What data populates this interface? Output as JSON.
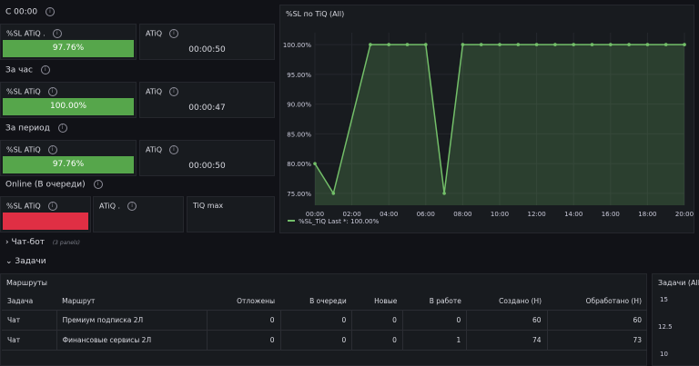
{
  "rows": [
    {
      "label": "С 00:00",
      "sl_title": "%SL ATiQ .",
      "sl_value": "97.76%",
      "atiq_title": "ATiQ",
      "atiq_value": "00:00:50"
    },
    {
      "label": "За час",
      "sl_title": "%SL ATiQ",
      "sl_value": "100.00%",
      "atiq_title": "ATiQ",
      "atiq_value": "00:00:47"
    },
    {
      "label": "За период",
      "sl_title": "%SL ATiQ",
      "sl_value": "97.76%",
      "atiq_title": "ATiQ",
      "atiq_value": "00:00:50"
    }
  ],
  "online": {
    "label": "Online (В очереди)",
    "sl_title": "%SL ATiQ",
    "atiq_title": "ATiQ .",
    "tiqmax_title": "TiQ max"
  },
  "info_glyph": "i",
  "chatbot": {
    "label": "Чат-бот",
    "panels": "(3 panels)"
  },
  "tasks": {
    "label": "Задачи"
  },
  "routes": {
    "title": "Маршруты",
    "columns": [
      "Задача",
      "Маршрут",
      "Отложены",
      "В очереди",
      "Новые",
      "В работе",
      "Создано (Н)",
      "Обработано (Н)"
    ],
    "rows": [
      [
        "Чат",
        "Премиум подписка 2Л",
        "0",
        "0",
        "0",
        "0",
        "60",
        "60"
      ],
      [
        "Чат",
        "Финансовые сервисы 2Л",
        "0",
        "0",
        "0",
        "1",
        "74",
        "73"
      ]
    ]
  },
  "tasks_panel": {
    "title": "Задачи (All)",
    "ticks": [
      "15",
      "12.5",
      "10"
    ]
  },
  "chart_data": {
    "type": "area",
    "title": "%SL по TiQ (All)",
    "x": [
      "00:00",
      "01:00",
      "03:00",
      "04:00",
      "05:00",
      "06:00",
      "07:00",
      "08:00",
      "09:00",
      "10:00",
      "11:00",
      "12:00",
      "13:00",
      "14:00",
      "15:00",
      "16:00",
      "17:00",
      "18:00",
      "19:00",
      "20:00"
    ],
    "x_ticks": [
      "00:00",
      "02:00",
      "04:00",
      "06:00",
      "08:00",
      "10:00",
      "12:00",
      "14:00",
      "16:00",
      "18:00",
      "20:00"
    ],
    "series": [
      {
        "name": "%SL_TiQ",
        "values": [
          80,
          75,
          100,
          100,
          100,
          100,
          75,
          100,
          100,
          100,
          100,
          100,
          100,
          100,
          100,
          100,
          100,
          100,
          100,
          100
        ]
      }
    ],
    "ylim": [
      73,
      102
    ],
    "y_ticks": [
      75,
      80,
      85,
      90,
      95,
      100
    ],
    "legend_text": "Last *: 100.00%",
    "color": "#73bf69"
  }
}
